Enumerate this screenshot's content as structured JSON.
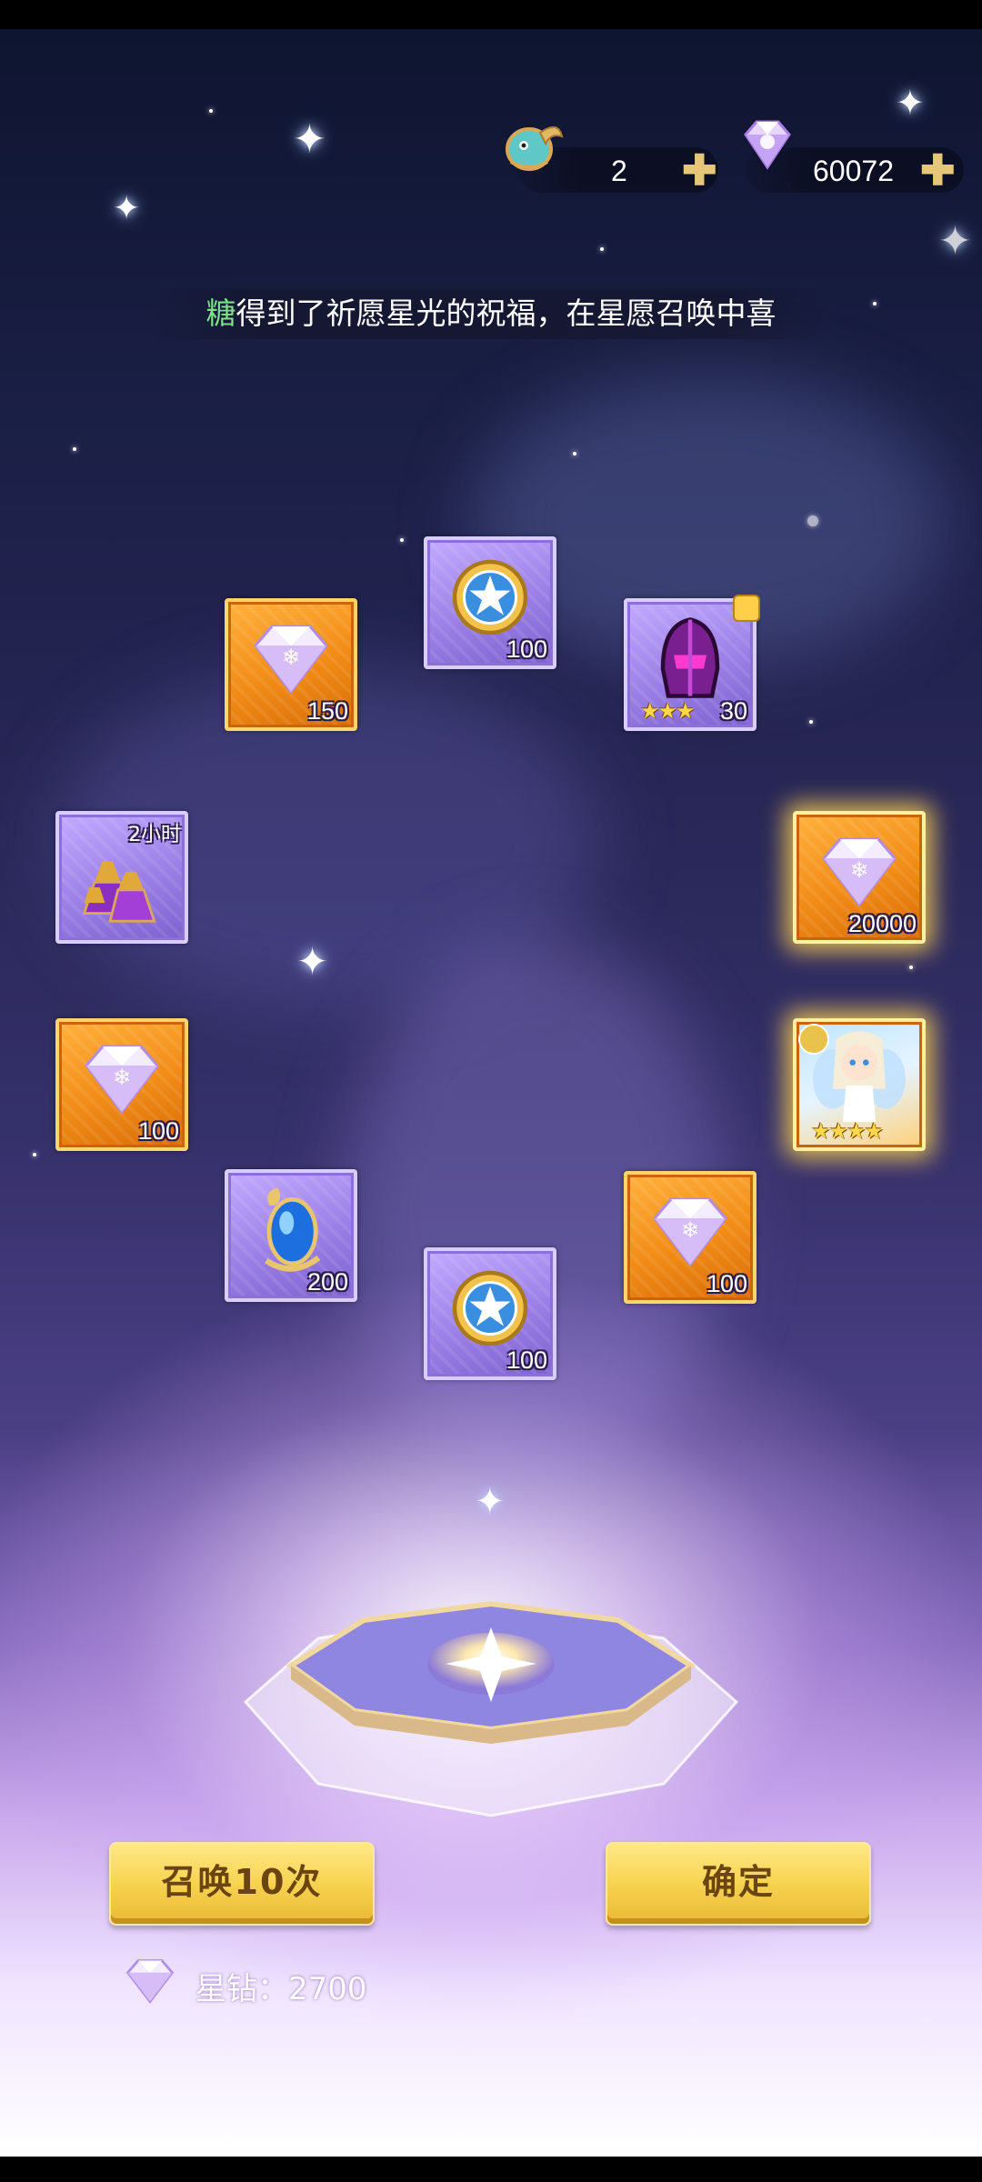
{
  "header": {
    "currency_pet": {
      "icon": "pet-egg-icon",
      "amount": "2"
    },
    "currency_gem": {
      "icon": "star-diamond-icon",
      "amount": "60072"
    }
  },
  "message": {
    "player_name": "糖",
    "text": "得到了祈愿星光的祝福，在星愿召唤中喜"
  },
  "rewards": [
    {
      "icon": "star-diamond-icon",
      "qty": "150",
      "rarity": "orange"
    },
    {
      "icon": "summon-coin-icon",
      "qty": "100",
      "rarity": "purple"
    },
    {
      "icon": "purple-helmet-icon",
      "qty": "30",
      "rarity": "purple",
      "stars": 3
    },
    {
      "icon": "potion-bottles-icon",
      "tag": "2小时",
      "rarity": "purple"
    },
    {
      "icon": "star-diamond-icon",
      "qty": "20000",
      "rarity": "orange"
    },
    {
      "icon": "star-diamond-icon",
      "qty": "100",
      "rarity": "orange"
    },
    {
      "icon": "fairy-hero-icon",
      "rarity": "orange",
      "stars": 4
    },
    {
      "icon": "blue-gem-icon",
      "qty": "200",
      "rarity": "purple"
    },
    {
      "icon": "star-diamond-icon",
      "qty": "100",
      "rarity": "orange"
    },
    {
      "icon": "summon-coin-icon",
      "qty": "100",
      "rarity": "purple"
    }
  ],
  "buttons": {
    "summon": "召唤10次",
    "confirm": "确定"
  },
  "cost": {
    "icon": "star-diamond-icon",
    "label": "星钻：2700"
  },
  "colors": {
    "name_highlight": "#7fe08a",
    "button_yellow": "#f7d350",
    "tile_orange": "#f18b16",
    "tile_purple": "#9b7fe6"
  }
}
